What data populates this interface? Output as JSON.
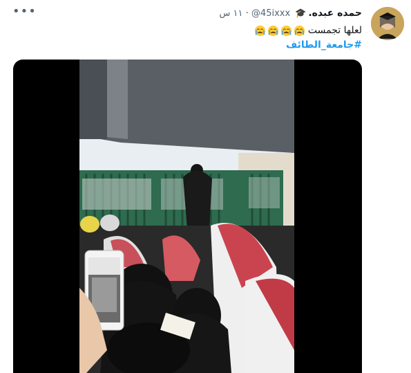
{
  "tweet": {
    "display_name": "حمده عبده.",
    "handle": "@45ixxx",
    "separator": "·",
    "time": "١١ س",
    "text": "لعلها تجمست",
    "emoji_count": 4,
    "hashtag": "#جامعة_الطائف"
  },
  "icons": {
    "more": "more-icon",
    "graduation_cap": "graduation-cap-icon",
    "crying_emoji": "crying-face-icon"
  },
  "colors": {
    "hashtag": "#1d9bf0",
    "secondary_text": "#536471",
    "media_background": "#000000"
  }
}
